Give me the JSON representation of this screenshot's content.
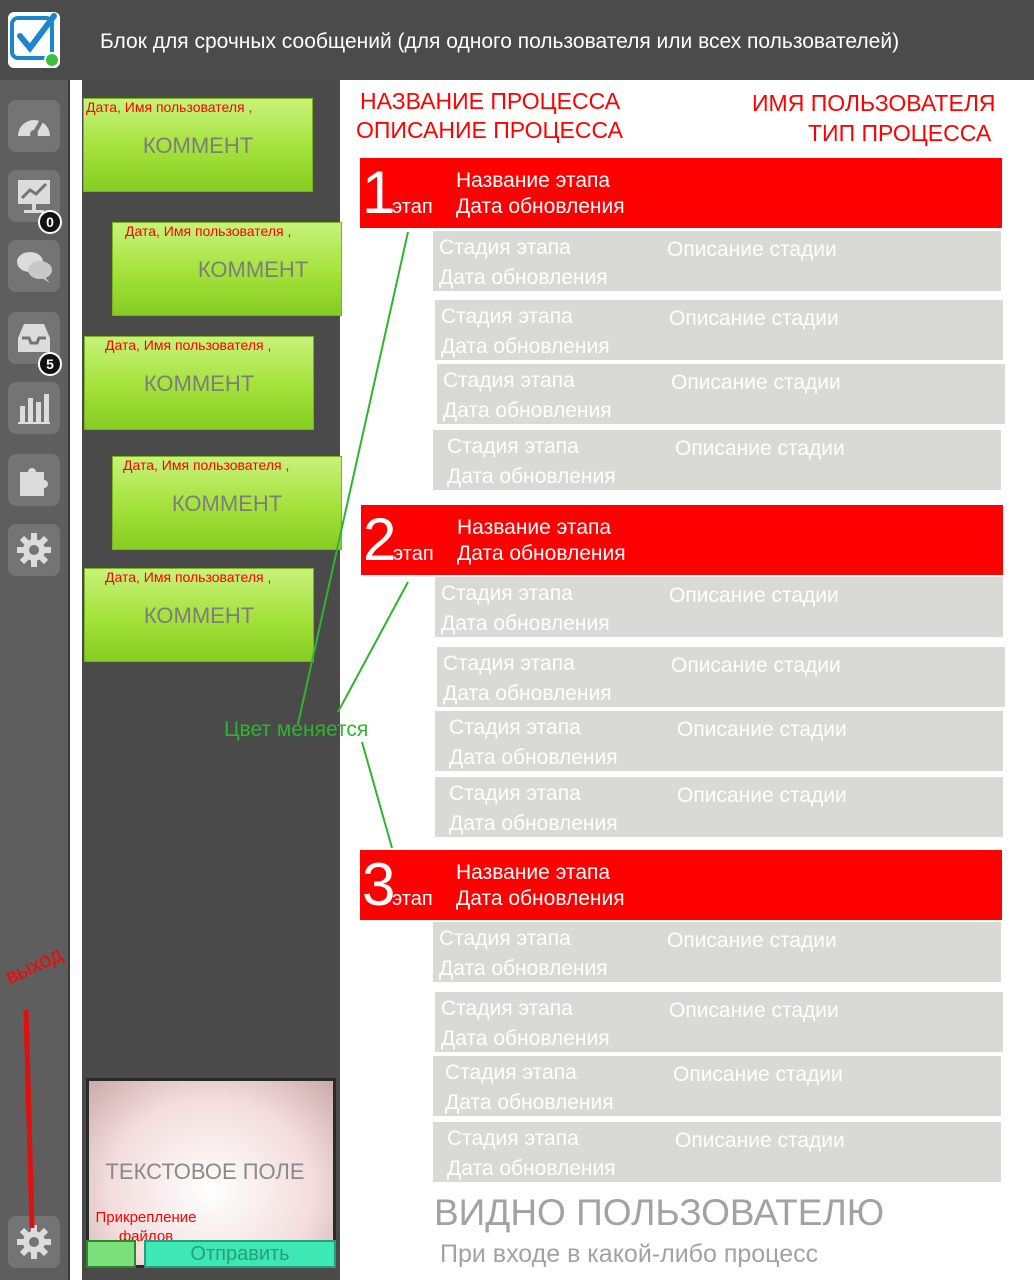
{
  "header": {
    "title": "Блок для срочных сообщений (для одного пользователя или всех пользователей)",
    "logo_icon": "checkmark-logo-icon"
  },
  "sidebar": {
    "items": [
      {
        "icon": "dashboard-icon",
        "badge": ""
      },
      {
        "icon": "presentation-chart-icon",
        "badge": "0"
      },
      {
        "icon": "chat-bubbles-icon",
        "badge": ""
      },
      {
        "icon": "inbox-icon",
        "badge": "5"
      },
      {
        "icon": "bar-chart-icon",
        "badge": ""
      },
      {
        "icon": "puzzle-icon",
        "badge": ""
      },
      {
        "icon": "gear-icon",
        "badge": ""
      }
    ],
    "exit_label": "выход",
    "exit_icon": "gear-icon"
  },
  "comments": [
    {
      "meta": "Дата, Имя пользователя ,",
      "text": "КОММЕНТ"
    },
    {
      "meta": "Дата, Имя пользователя ,",
      "text": "КОММЕНТ"
    },
    {
      "meta": "Дата, Имя пользователя ,",
      "text": "КОММЕНТ"
    },
    {
      "meta": "Дата, Имя пользователя ,",
      "text": "КОММЕНТ"
    },
    {
      "meta": "Дата, Имя пользователя ,",
      "text": "КОММЕНТ"
    }
  ],
  "composer": {
    "text_field": "ТЕКСТОВОЕ ПОЛЕ",
    "attach_label": "Прикрепление файлов",
    "send_label": "Отправить"
  },
  "process": {
    "name": "НАЗВАНИЕ ПРОЦЕССА",
    "description": "ОПИСАНИЕ ПРОЦЕССА",
    "user_name": "ИМЯ ПОЛЬЗОВАТЕЛЯ",
    "type": "ТИП ПРОЦЕССА"
  },
  "stages": [
    {
      "number": "1",
      "suffix": "этап",
      "name": "Название этапа",
      "updated": "Дата обновления",
      "substages": [
        {
          "stage": "Стадия этапа",
          "updated": "Дата обновления",
          "description": "Описание стадии"
        },
        {
          "stage": "Стадия этапа",
          "updated": "Дата обновления",
          "description": "Описание стадии"
        },
        {
          "stage": "Стадия этапа",
          "updated": "Дата обновления",
          "description": "Описание стадии"
        },
        {
          "stage": "Стадия этапа",
          "updated": "Дата обновления",
          "description": "Описание стадии"
        }
      ]
    },
    {
      "number": "2",
      "suffix": "этап",
      "name": "Название этапа",
      "updated": "Дата обновления",
      "substages": [
        {
          "stage": "Стадия этапа",
          "updated": "Дата обновления",
          "description": "Описание стадии"
        },
        {
          "stage": "Стадия этапа",
          "updated": "Дата обновления",
          "description": "Описание стадии"
        },
        {
          "stage": "Стадия этапа",
          "updated": "Дата обновления",
          "description": "Описание стадии"
        },
        {
          "stage": "Стадия этапа",
          "updated": "Дата обновления",
          "description": "Описание стадии"
        }
      ]
    },
    {
      "number": "3",
      "suffix": "этап",
      "name": "Название этапа",
      "updated": "Дата обновления",
      "substages": [
        {
          "stage": "Стадия этапа",
          "updated": "Дата обновления",
          "description": "Описание стадии"
        },
        {
          "stage": "Стадия этапа",
          "updated": "Дата обновления",
          "description": "Описание стадии"
        },
        {
          "stage": "Стадия этапа",
          "updated": "Дата обновления",
          "description": "Описание стадии"
        },
        {
          "stage": "Стадия этапа",
          "updated": "Дата обновления",
          "description": "Описание стадии"
        }
      ]
    }
  ],
  "annotation": {
    "color_changes": "Цвет меняется"
  },
  "footer": {
    "visible_to_user": "ВИДНО ПОЛЬЗОВАТЕЛЮ",
    "on_entry": "При входе в какой-либо процесс"
  },
  "colors": {
    "stage_bar": "#ff0000",
    "substage_bg": "#d9d9d5",
    "comment_green": "#a3e23a",
    "annotation_green": "#2db52d",
    "header_bg": "#4b4b4b"
  }
}
